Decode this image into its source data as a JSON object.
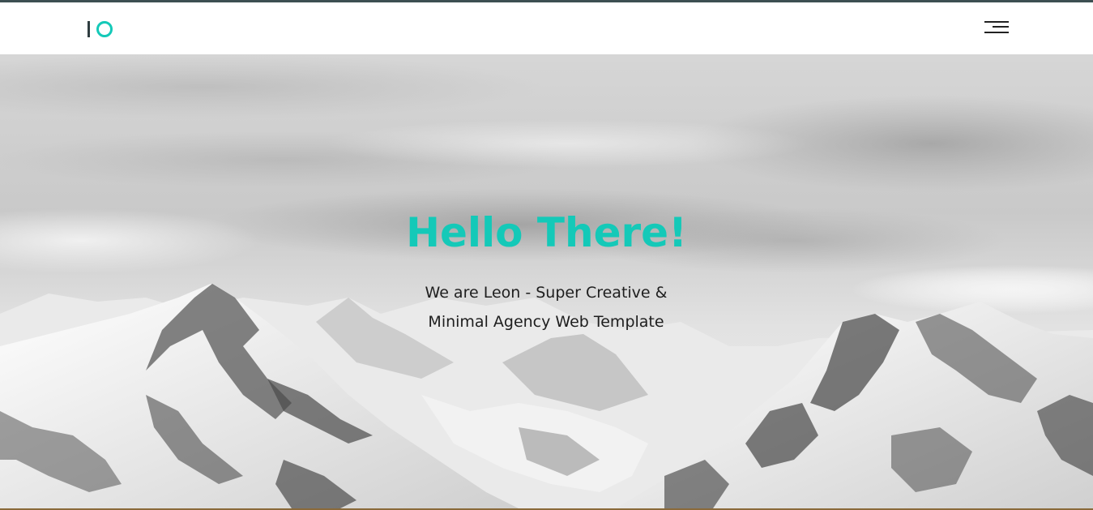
{
  "header": {
    "logo": {
      "text": "IO",
      "icon": "io-logo",
      "accent_color": "#14c9b8",
      "dark_color": "#2f3d40"
    },
    "menu": {
      "icon": "hamburger-menu-icon",
      "label": ""
    }
  },
  "hero": {
    "title": "Hello There!",
    "subtitle_line1": "We are Leon - Super Creative &",
    "subtitle_line2": "Minimal Agency Web Template",
    "title_color": "#14c9b8",
    "background": "grayscale snowy mountain range under cloudy sky"
  }
}
